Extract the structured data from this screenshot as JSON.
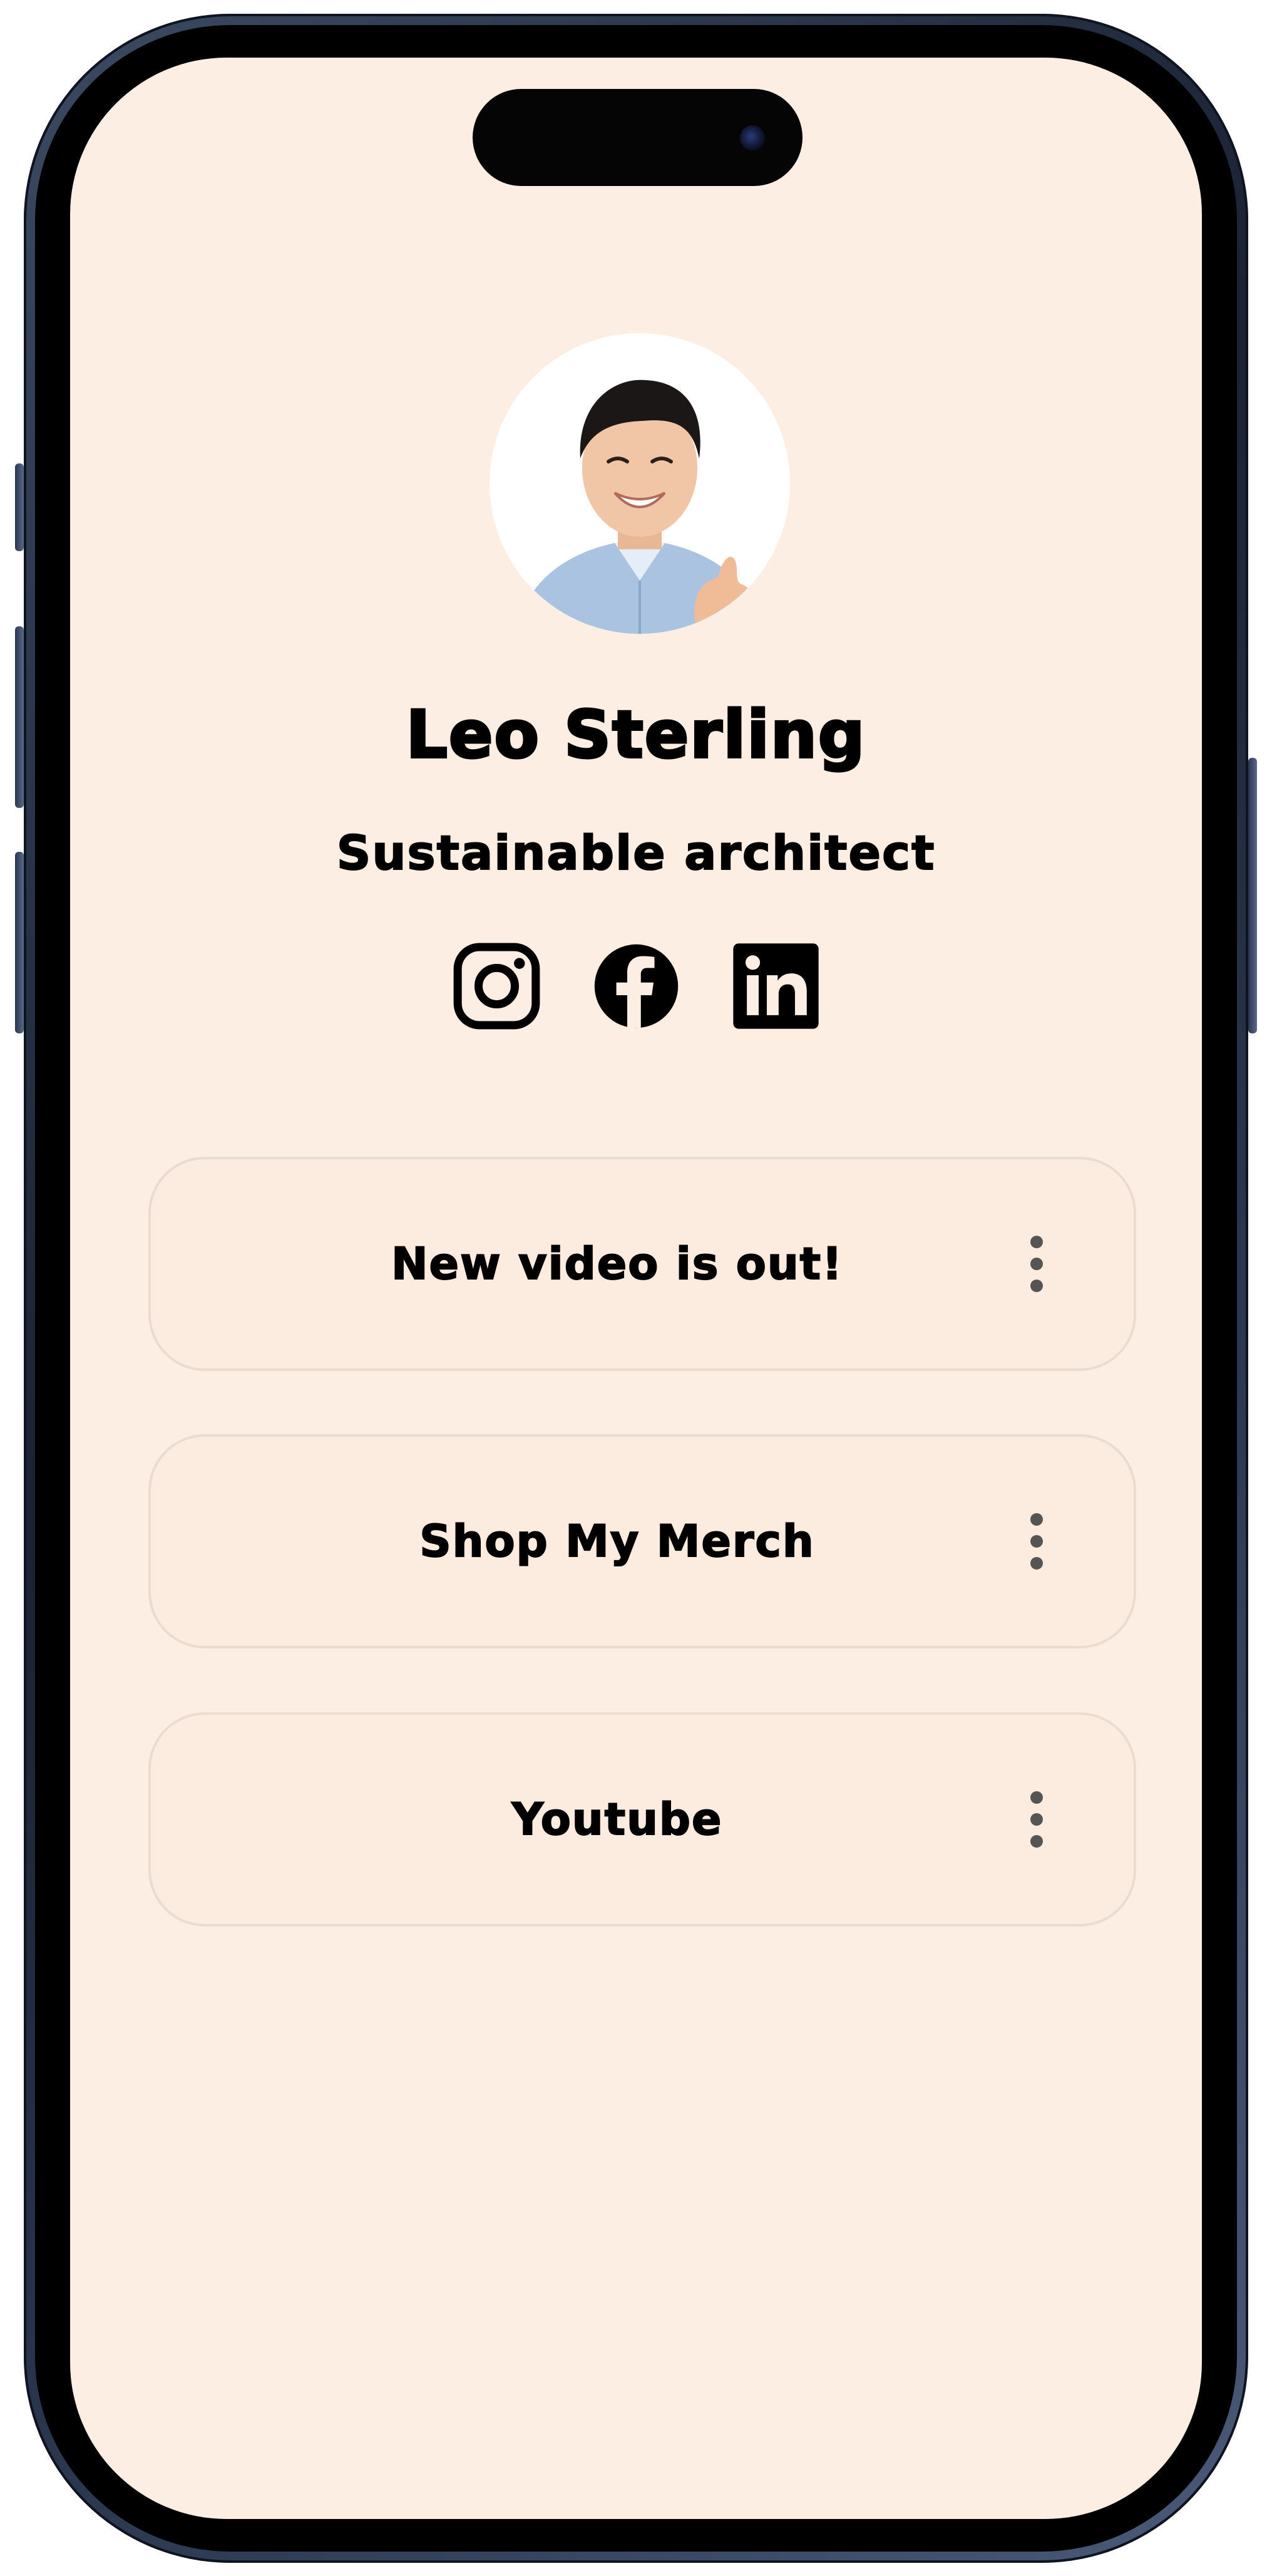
{
  "profile": {
    "name": "Leo Sterling",
    "tagline": "Sustainable architect",
    "avatar_icon": "profile-photo"
  },
  "socials": [
    {
      "icon": "instagram-icon",
      "label": "Instagram"
    },
    {
      "icon": "facebook-icon",
      "label": "Facebook"
    },
    {
      "icon": "linkedin-icon",
      "label": "LinkedIn"
    }
  ],
  "links": [
    {
      "label": "New video is out!",
      "menu_icon": "more-vertical-icon"
    },
    {
      "label": "Shop My Merch",
      "menu_icon": "more-vertical-icon"
    },
    {
      "label": "Youtube",
      "menu_icon": "more-vertical-icon"
    }
  ],
  "colors": {
    "background": "#fdeee3",
    "card_border": "#e8dcd3",
    "text": "#000000",
    "kebab": "#555555"
  }
}
